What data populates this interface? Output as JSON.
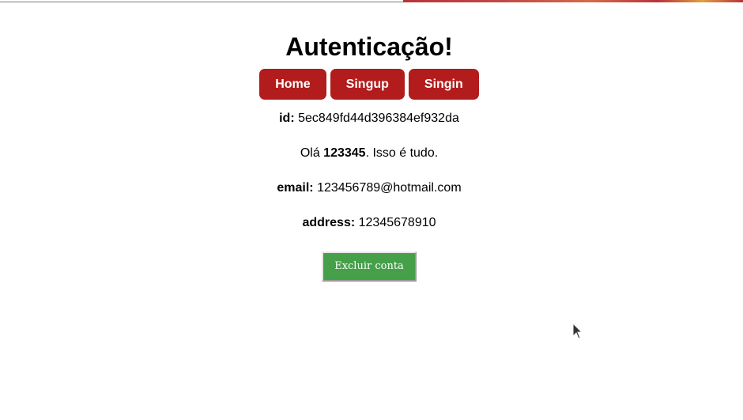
{
  "title": "Autenticação!",
  "nav": {
    "items": [
      {
        "label": "Home"
      },
      {
        "label": "Singup"
      },
      {
        "label": "Singin"
      }
    ]
  },
  "user": {
    "id_label": "id:",
    "id_value": "5ec849fd44d396384ef932da",
    "greeting_prefix": "Olá ",
    "name": "123345",
    "greeting_suffix": ". Isso é tudo.",
    "email_label": "email:",
    "email_value": "123456789@hotmail.com",
    "address_label": "address:",
    "address_value": "12345678910"
  },
  "actions": {
    "delete_label": "Excluir conta"
  },
  "colors": {
    "nav_button": "#b21c1c",
    "delete_button": "#45a049"
  }
}
